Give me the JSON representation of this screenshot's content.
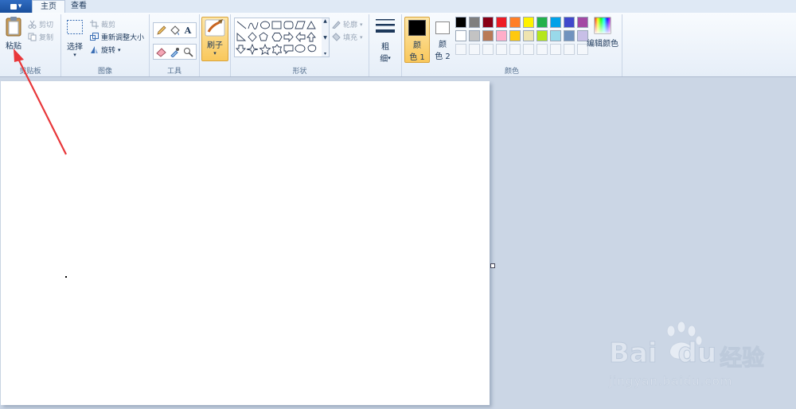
{
  "tabs": {
    "app_menu_arrow": "▾",
    "home": "主页",
    "view": "查看"
  },
  "clipboard": {
    "paste": "粘贴",
    "cut": "剪切",
    "copy": "复制",
    "label": "剪贴板"
  },
  "image": {
    "select": "选择",
    "crop": "裁剪",
    "resize": "重新调整大小",
    "rotate": "旋转",
    "label": "图像"
  },
  "tools": {
    "label": "工具",
    "text_tool": "A"
  },
  "brushes": {
    "label": "刷子"
  },
  "shapes": {
    "outline": "轮廓",
    "fill": "填充",
    "label": "形状"
  },
  "size": {
    "label_line1": "粗",
    "label_line2": "细"
  },
  "colors": {
    "color1_line1": "颜",
    "color1_line2": "色 1",
    "color2_line1": "颜",
    "color2_line2": "色 2",
    "edit_colors": "编辑颜色",
    "label": "颜色",
    "color1_value": "#000000",
    "color2_value": "#ffffff",
    "palette_row1": [
      "#000000",
      "#7f7f7f",
      "#880015",
      "#ed1c24",
      "#ff7f27",
      "#fff200",
      "#22b14c",
      "#00a2e8",
      "#3f48cc",
      "#a349a4"
    ],
    "palette_row2": [
      "#ffffff",
      "#c3c3c3",
      "#b97a57",
      "#ffaec9",
      "#ffc90e",
      "#efe4b0",
      "#b5e61d",
      "#99d9ea",
      "#7092be",
      "#c8bfe7"
    ]
  },
  "annotation": {
    "arrow_color": "#e8373a"
  },
  "watermark": {
    "brand_text": "Bai",
    "brand_text2": "du",
    "brand_cn": "经验",
    "url": "jingyan.baidu.com"
  }
}
